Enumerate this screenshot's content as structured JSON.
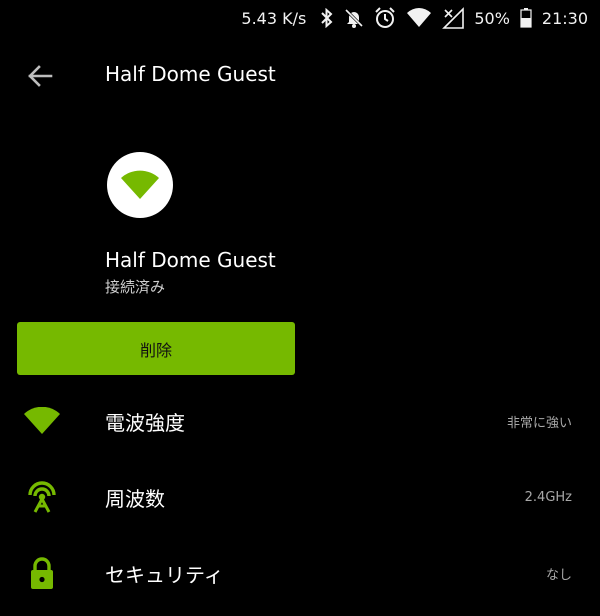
{
  "status_bar": {
    "speed": "5.43 K/s",
    "battery": "50%",
    "time": "21:30"
  },
  "app_bar": {
    "title": "Half Dome Guest"
  },
  "network": {
    "name": "Half Dome Guest",
    "status": "接続済み"
  },
  "actions": {
    "delete_label": "削除"
  },
  "details": [
    {
      "label": "電波強度",
      "value": "非常に強い",
      "icon": "wifi-signal-icon"
    },
    {
      "label": "周波数",
      "value": "2.4GHz",
      "icon": "antenna-icon"
    },
    {
      "label": "セキュリティ",
      "value": "なし",
      "icon": "lock-icon"
    }
  ],
  "colors": {
    "accent": "#76b900",
    "background": "#000000"
  }
}
